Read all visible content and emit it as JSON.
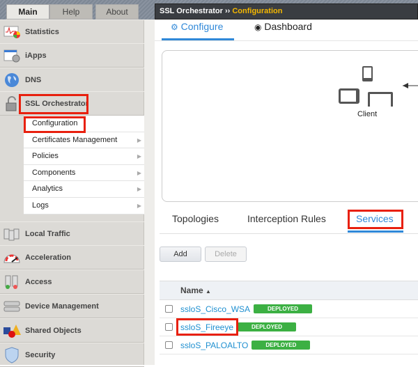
{
  "top_tabs": [
    "Main",
    "Help",
    "About"
  ],
  "header": {
    "app": "SSL Orchestrator",
    "sep": "››",
    "current": "Configuration"
  },
  "sidebar": {
    "items": [
      {
        "label": "Statistics",
        "icon": "statistics-icon"
      },
      {
        "label": "iApps",
        "icon": "iapps-icon"
      },
      {
        "label": "DNS",
        "icon": "globe-icon"
      },
      {
        "label": "SSL Orchestrator",
        "icon": "lock-icon"
      },
      {
        "label": "Local Traffic",
        "icon": "servers-icon"
      },
      {
        "label": "Acceleration",
        "icon": "gauge-icon"
      },
      {
        "label": "Access",
        "icon": "access-icon"
      },
      {
        "label": "Device Management",
        "icon": "device-icon"
      },
      {
        "label": "Shared Objects",
        "icon": "shapes-icon"
      },
      {
        "label": "Security",
        "icon": "shield-icon"
      }
    ],
    "submenu": [
      "Configuration",
      "Certificates Management",
      "Policies",
      "Components",
      "Analytics",
      "Logs"
    ]
  },
  "main": {
    "tabs": [
      {
        "label": "Configure",
        "active": true
      },
      {
        "label": "Dashboard"
      }
    ],
    "diagram": {
      "client_label": "Client"
    },
    "subtabs": [
      "Topologies",
      "Interception Rules",
      "Services"
    ],
    "active_subtab": "Services",
    "buttons": {
      "add": "Add",
      "delete": "Delete"
    },
    "table": {
      "header": "Name",
      "sort": "▲",
      "rows": [
        {
          "name": "ssloS_Cisco_WSA",
          "status": "DEPLOYED"
        },
        {
          "name": "ssloS_Fireeye",
          "status": "DEPLOYED"
        },
        {
          "name": "ssloS_PALOALTO",
          "status": "DEPLOYED"
        }
      ]
    }
  },
  "colors": {
    "highlight": "#e8200e",
    "link": "#1e8fd0",
    "deployed": "#3cb043",
    "accent": "#f5b800"
  }
}
